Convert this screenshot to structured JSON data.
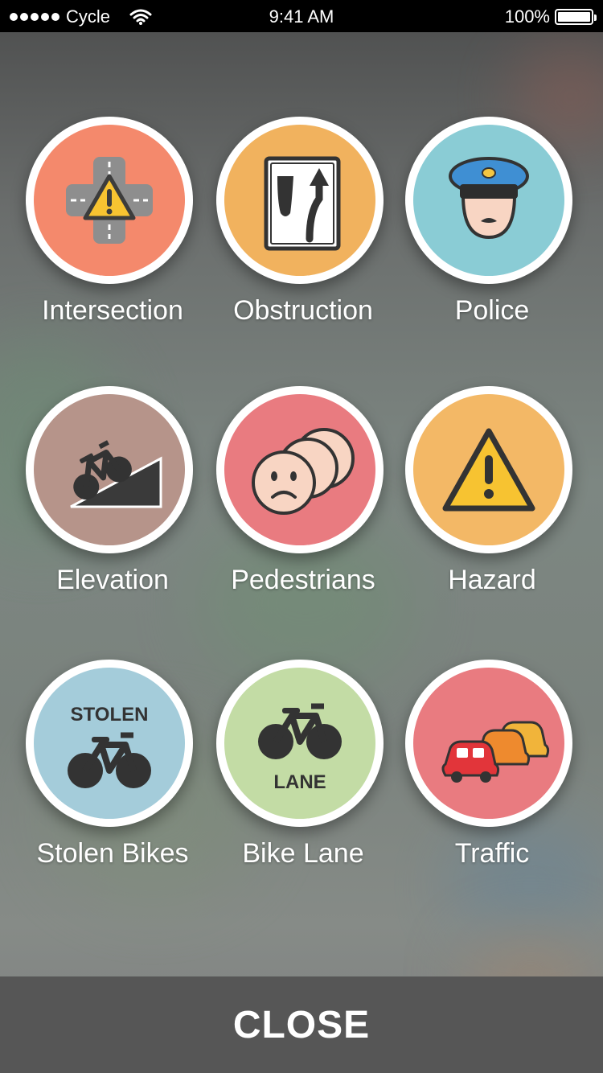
{
  "status_bar": {
    "carrier": "Cycle",
    "time": "9:41 AM",
    "battery": "100%",
    "signal_icon": "signal-dots-icon",
    "wifi_icon": "wifi-icon",
    "battery_icon": "battery-icon"
  },
  "report_grid": {
    "items": [
      {
        "label": "Intersection",
        "icon": "intersection-icon",
        "color": "#F4896C"
      },
      {
        "label": "Obstruction",
        "icon": "obstruction-icon",
        "color": "#F1B25E"
      },
      {
        "label": "Police",
        "icon": "police-icon",
        "color": "#8ACCD5"
      },
      {
        "label": "Elevation",
        "icon": "elevation-icon",
        "color": "#B6948A"
      },
      {
        "label": "Pedestrians",
        "icon": "pedestrians-icon",
        "color": "#E97B80"
      },
      {
        "label": "Hazard",
        "icon": "hazard-icon",
        "color": "#F3B866"
      },
      {
        "label": "Stolen Bikes",
        "icon": "stolen-bikes-icon",
        "color": "#A4CCDA",
        "badge": "STOLEN"
      },
      {
        "label": "Bike Lane",
        "icon": "bike-lane-icon",
        "color": "#C3DCA5",
        "badge": "LANE"
      },
      {
        "label": "Traffic",
        "icon": "traffic-icon",
        "color": "#E97B80"
      }
    ]
  },
  "footer": {
    "close_label": "CLOSE"
  }
}
